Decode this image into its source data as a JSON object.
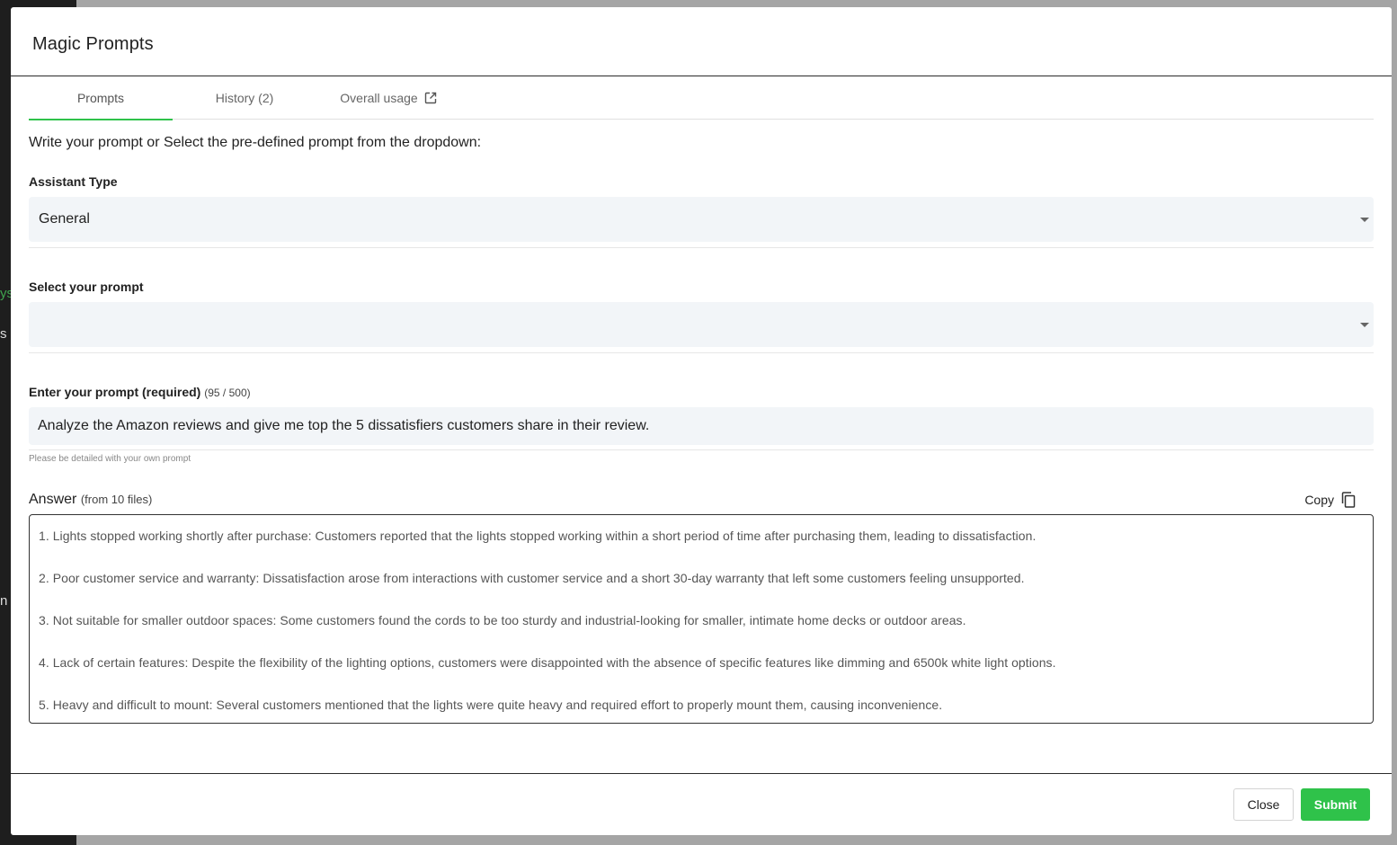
{
  "background": {
    "fragments": [
      "ys",
      "s",
      "n"
    ]
  },
  "modal": {
    "title": "Magic Prompts"
  },
  "tabs": [
    {
      "label": "Prompts"
    },
    {
      "label": "History (2)"
    },
    {
      "label": "Overall usage"
    }
  ],
  "instruction": "Write your prompt or Select the pre-defined prompt from the dropdown:",
  "assistant_type": {
    "label": "Assistant Type",
    "value": "General"
  },
  "select_prompt": {
    "label": "Select your prompt",
    "value": ""
  },
  "enter_prompt": {
    "label": "Enter your prompt (required)",
    "counter": "(95 / 500)",
    "value": "Analyze the Amazon reviews and give me top the 5 dissatisfiers customers share in their review.",
    "hint": "Please be detailed with your own prompt"
  },
  "answer": {
    "title": "Answer",
    "source": "(from 10 files)",
    "copy_label": "Copy",
    "lines": [
      "1. Lights stopped working shortly after purchase: Customers reported that the lights stopped working within a short period of time after purchasing them, leading to dissatisfaction.",
      "2. Poor customer service and warranty: Dissatisfaction arose from interactions with customer service and a short 30-day warranty that left some customers feeling unsupported.",
      "3. Not suitable for smaller outdoor spaces: Some customers found the cords to be too sturdy and industrial-looking for smaller, intimate home decks or outdoor areas.",
      "4. Lack of certain features: Despite the flexibility of the lighting options, customers were disappointed with the absence of specific features like dimming and 6500k white light options.",
      "5. Heavy and difficult to mount: Several customers mentioned that the lights were quite heavy and required effort to properly mount them, causing inconvenience."
    ]
  },
  "footer": {
    "close_label": "Close",
    "submit_label": "Submit"
  },
  "colors": {
    "accent": "#2fc24a",
    "field_bg": "#f2f5f8"
  },
  "icons": {
    "external_link": "external-link-icon",
    "copy": "copy-icon",
    "dropdown": "caret-down-icon"
  }
}
